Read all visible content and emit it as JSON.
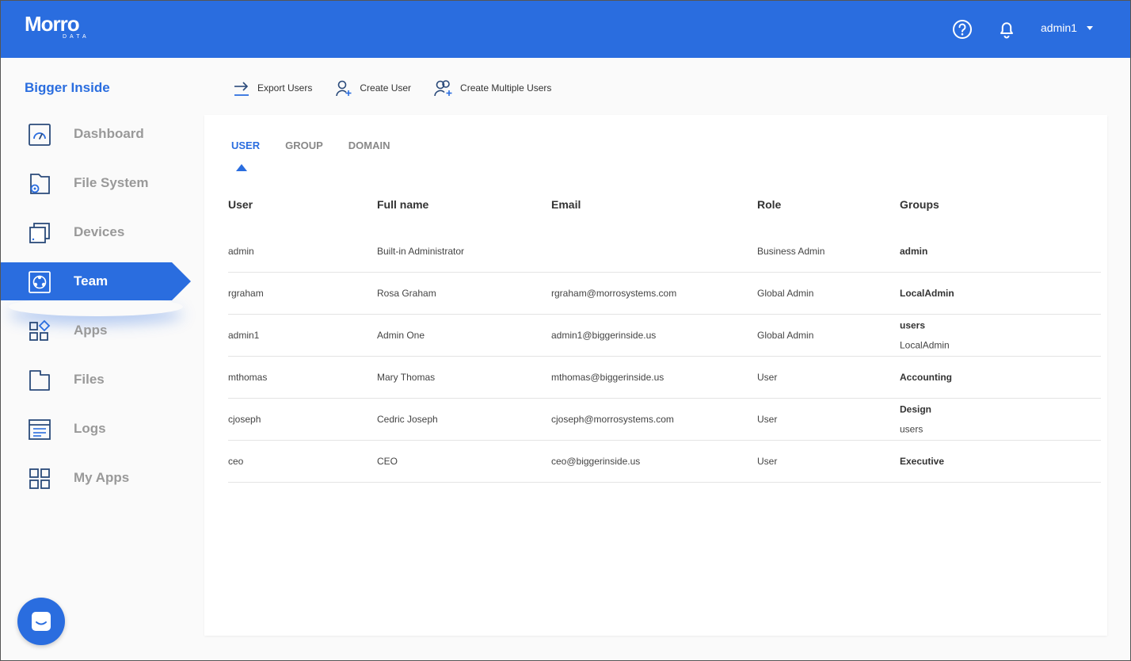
{
  "header": {
    "logo_main": "Morro",
    "logo_sub": "DATA",
    "username": "admin1",
    "help_icon": "help-circle-icon",
    "notification_icon": "bell-icon"
  },
  "sidebar": {
    "org_name": "Bigger Inside",
    "items": [
      {
        "label": "Dashboard",
        "icon": "dashboard-gauge-icon"
      },
      {
        "label": "File System",
        "icon": "file-system-gear-icon"
      },
      {
        "label": "Devices",
        "icon": "devices-icon"
      },
      {
        "label": "Team",
        "icon": "team-icon",
        "active": true
      },
      {
        "label": "Apps",
        "icon": "apps-grid-icon"
      },
      {
        "label": "Files",
        "icon": "files-folder-icon"
      },
      {
        "label": "Logs",
        "icon": "logs-icon"
      },
      {
        "label": "My Apps",
        "icon": "my-apps-grid-icon"
      }
    ]
  },
  "actions": {
    "export": "Export Users",
    "create": "Create User",
    "create_multiple": "Create Multiple Users"
  },
  "tabs": {
    "user": "USER",
    "group": "GROUP",
    "domain": "DOMAIN",
    "active": "USER"
  },
  "table": {
    "headers": {
      "user": "User",
      "full_name": "Full name",
      "email": "Email",
      "role": "Role",
      "groups": "Groups"
    },
    "rows": [
      {
        "user": "admin",
        "full_name": "Built-in Administrator",
        "email": "",
        "role": "Business Admin",
        "groups": [
          "admin"
        ]
      },
      {
        "user": "rgraham",
        "full_name": "Rosa Graham",
        "email": "rgraham@morrosystems.com",
        "role": "Global Admin",
        "groups": [
          "LocalAdmin"
        ]
      },
      {
        "user": "admin1",
        "full_name": "Admin One",
        "email": "admin1@biggerinside.us",
        "role": "Global Admin",
        "groups": [
          "users",
          "LocalAdmin"
        ]
      },
      {
        "user": "mthomas",
        "full_name": "Mary Thomas",
        "email": "mthomas@biggerinside.us",
        "role": "User",
        "groups": [
          "Accounting"
        ]
      },
      {
        "user": "cjoseph",
        "full_name": "Cedric Joseph",
        "email": "cjoseph@morrosystems.com",
        "role": "User",
        "groups": [
          "Design",
          "users"
        ]
      },
      {
        "user": "ceo",
        "full_name": "CEO",
        "email": "ceo@biggerinside.us",
        "role": "User",
        "groups": [
          "Executive"
        ]
      }
    ]
  },
  "chat": {
    "icon": "chat-icon"
  },
  "colors": {
    "primary": "#2a6ddf",
    "muted": "#999999",
    "background": "#fafafa"
  }
}
